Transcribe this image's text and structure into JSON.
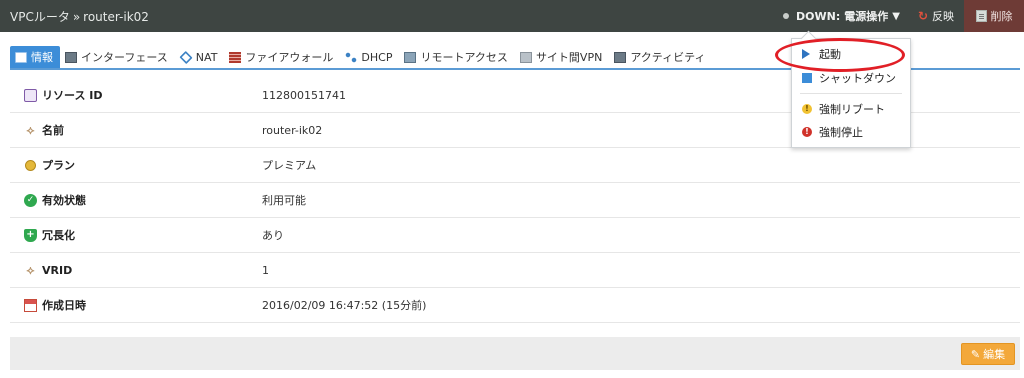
{
  "header": {
    "breadcrumb_parent": "VPCルータ",
    "breadcrumb_sep": "»",
    "breadcrumb_current": "router-ik02",
    "status": "DOWN:",
    "power_label": "電源操作",
    "power_caret": "▼",
    "reflect_label": "反映",
    "reflect_icon": "↻",
    "delete_label": "削除"
  },
  "tabs": [
    {
      "label": "情報",
      "icon": "info-icon"
    },
    {
      "label": "インターフェース",
      "icon": "monitor-icon"
    },
    {
      "label": "NAT",
      "icon": "nat-icon"
    },
    {
      "label": "ファイアウォール",
      "icon": "firewall-icon"
    },
    {
      "label": "DHCP",
      "icon": "dhcp-icon"
    },
    {
      "label": "リモートアクセス",
      "icon": "remote-icon"
    },
    {
      "label": "サイト間VPN",
      "icon": "site-vpn-icon"
    },
    {
      "label": "アクティビティ",
      "icon": "activity-icon"
    }
  ],
  "details": [
    {
      "label": "リソース ID",
      "value": "112800151741",
      "icon": "id-card-icon"
    },
    {
      "label": "名前",
      "value": "router-ik02",
      "icon": "tag-icon"
    },
    {
      "label": "プラン",
      "value": "プレミアム",
      "icon": "award-icon"
    },
    {
      "label": "有効状態",
      "value": "利用可能",
      "icon": "check-circle-icon"
    },
    {
      "label": "冗長化",
      "value": "あり",
      "icon": "shield-plus-icon"
    },
    {
      "label": "VRID",
      "value": "1",
      "icon": "tag-icon"
    },
    {
      "label": "作成日時",
      "value": "2016/02/09 16:47:52 (15分前)",
      "icon": "calendar-icon"
    }
  ],
  "footer": {
    "edit_label": "編集",
    "edit_icon": "✎"
  },
  "power_menu": {
    "items": [
      {
        "label": "起動",
        "icon": "play-icon"
      },
      {
        "label": "シャットダウン",
        "icon": "stop-icon"
      },
      {
        "label": "強制リブート",
        "icon": "warning-icon"
      },
      {
        "label": "強制停止",
        "icon": "error-icon"
      }
    ],
    "warn_glyph": "!",
    "err_glyph": "!"
  },
  "colors": {
    "topbar": "#3e4542",
    "delete_bg": "#6e3b36",
    "active_tab": "#3c8dd8",
    "edit_button": "#f3a83a",
    "highlight": "#e11f26"
  }
}
